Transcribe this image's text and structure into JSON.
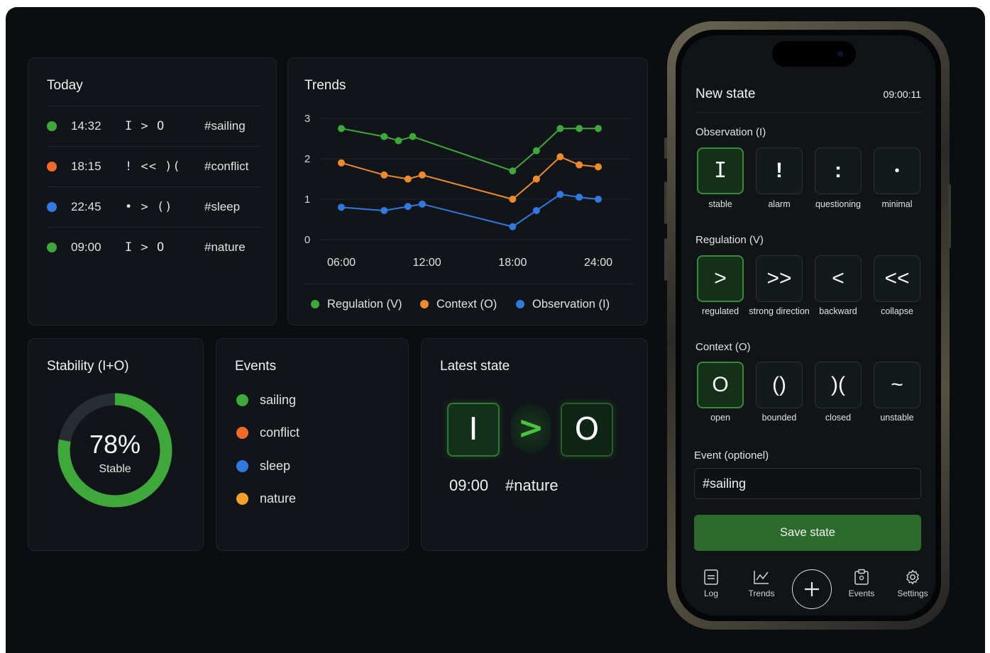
{
  "colors": {
    "green": "#3ea83b",
    "orange": "#ef6b2a",
    "blue": "#2f79e0",
    "amber": "#f4a02a",
    "accent_green": "#2c6a2d"
  },
  "today": {
    "title": "Today",
    "rows": [
      {
        "color": "#3ea83b",
        "time": "14:32",
        "expr": "I > O",
        "tag": "#sailing"
      },
      {
        "color": "#ef6b2a",
        "time": "18:15",
        "expr": "! << )(",
        "tag": "#conflict"
      },
      {
        "color": "#2f79e0",
        "time": "22:45",
        "expr": "• > ()",
        "tag": "#sleep"
      },
      {
        "color": "#3ea83b",
        "time": "09:00",
        "expr": "I > O",
        "tag": "#nature"
      }
    ]
  },
  "trends": {
    "title": "Trends",
    "legend": [
      {
        "label": "Regulation (V)",
        "color": "#3ea83b"
      },
      {
        "label": "Context (O)",
        "color": "#ef8a2a"
      },
      {
        "label": "Observation (I)",
        "color": "#2f79e0"
      }
    ]
  },
  "chart_data": {
    "type": "line",
    "title": "Trends",
    "x": [
      "06:00",
      "09:00",
      "12:00",
      "15:00",
      "18:00",
      "21:00",
      "24:00"
    ],
    "x_ticks": [
      "06:00",
      "12:00",
      "18:00",
      "24:00"
    ],
    "y_ticks": [
      "0",
      "1",
      "2",
      "3"
    ],
    "ylim": [
      0,
      3
    ],
    "grid": true,
    "legend_position": "bottom",
    "series": [
      {
        "name": "Regulation (V)",
        "color": "#3ea83b",
        "points": [
          [
            "06:00",
            2.75
          ],
          [
            "09:00",
            2.55
          ],
          [
            "10:00",
            2.45
          ],
          [
            "11:00",
            2.55
          ],
          [
            "18:00",
            1.7
          ],
          [
            "19:40",
            2.2
          ],
          [
            "21:20",
            2.75
          ],
          [
            "22:40",
            2.75
          ],
          [
            "24:00",
            2.75
          ]
        ]
      },
      {
        "name": "Context (O)",
        "color": "#ef8a2a",
        "points": [
          [
            "06:00",
            1.9
          ],
          [
            "09:00",
            1.6
          ],
          [
            "10:40",
            1.5
          ],
          [
            "11:40",
            1.6
          ],
          [
            "18:00",
            1.0
          ],
          [
            "19:40",
            1.5
          ],
          [
            "21:20",
            2.05
          ],
          [
            "22:40",
            1.85
          ],
          [
            "24:00",
            1.8
          ]
        ]
      },
      {
        "name": "Observation (I)",
        "color": "#2f79e0",
        "points": [
          [
            "06:00",
            0.8
          ],
          [
            "09:00",
            0.72
          ],
          [
            "10:40",
            0.82
          ],
          [
            "11:40",
            0.88
          ],
          [
            "18:00",
            0.32
          ],
          [
            "19:40",
            0.72
          ],
          [
            "21:20",
            1.12
          ],
          [
            "22:40",
            1.05
          ],
          [
            "24:00",
            1.0
          ]
        ]
      }
    ]
  },
  "stability": {
    "title": "Stability (I+O)",
    "percent_text": "78%",
    "value": 0.78,
    "sub": "Stable"
  },
  "events": {
    "title": "Events",
    "items": [
      {
        "label": "sailing",
        "color": "#3ea83b"
      },
      {
        "label": "conflict",
        "color": "#ef6b2a"
      },
      {
        "label": "sleep",
        "color": "#2f79e0"
      },
      {
        "label": "nature",
        "color": "#f4a02a"
      }
    ]
  },
  "latest": {
    "title": "Latest state",
    "observation": "I",
    "regulation": ">",
    "context": "O",
    "time": "09:00",
    "tag": "#nature"
  },
  "phone": {
    "title": "New state",
    "clock": "09:00:11",
    "observation": {
      "label": "Observation (I)",
      "options": [
        {
          "symbol": "I",
          "caption": "stable",
          "selected": true
        },
        {
          "symbol": "!",
          "caption": "alarm",
          "selected": false
        },
        {
          "symbol": ":",
          "caption": "questioning",
          "selected": false
        },
        {
          "symbol": "•",
          "caption": "minimal",
          "selected": false
        }
      ]
    },
    "regulation": {
      "label": "Regulation (V)",
      "options": [
        {
          "symbol": ">",
          "caption": "regulated",
          "selected": true
        },
        {
          "symbol": ">>",
          "caption": "strong direction",
          "selected": false
        },
        {
          "symbol": "<",
          "caption": "backward",
          "selected": false
        },
        {
          "symbol": "<<",
          "caption": "collapse",
          "selected": false
        }
      ]
    },
    "context": {
      "label": "Context (O)",
      "options": [
        {
          "symbol": "O",
          "caption": "open",
          "selected": true
        },
        {
          "symbol": "()",
          "caption": "bounded",
          "selected": false
        },
        {
          "symbol": ")(",
          "caption": "closed",
          "selected": false
        },
        {
          "symbol": "~",
          "caption": "unstable",
          "selected": false
        }
      ]
    },
    "event_label": "Event (optionel)",
    "event_value": "#sailing",
    "save_label": "Save state",
    "nav": [
      {
        "label": "Log",
        "icon": "log-icon"
      },
      {
        "label": "Trends",
        "icon": "trends-icon"
      },
      {
        "label": "",
        "icon": "plus-icon"
      },
      {
        "label": "Events",
        "icon": "events-icon"
      },
      {
        "label": "Settings",
        "icon": "gear-icon"
      }
    ]
  }
}
